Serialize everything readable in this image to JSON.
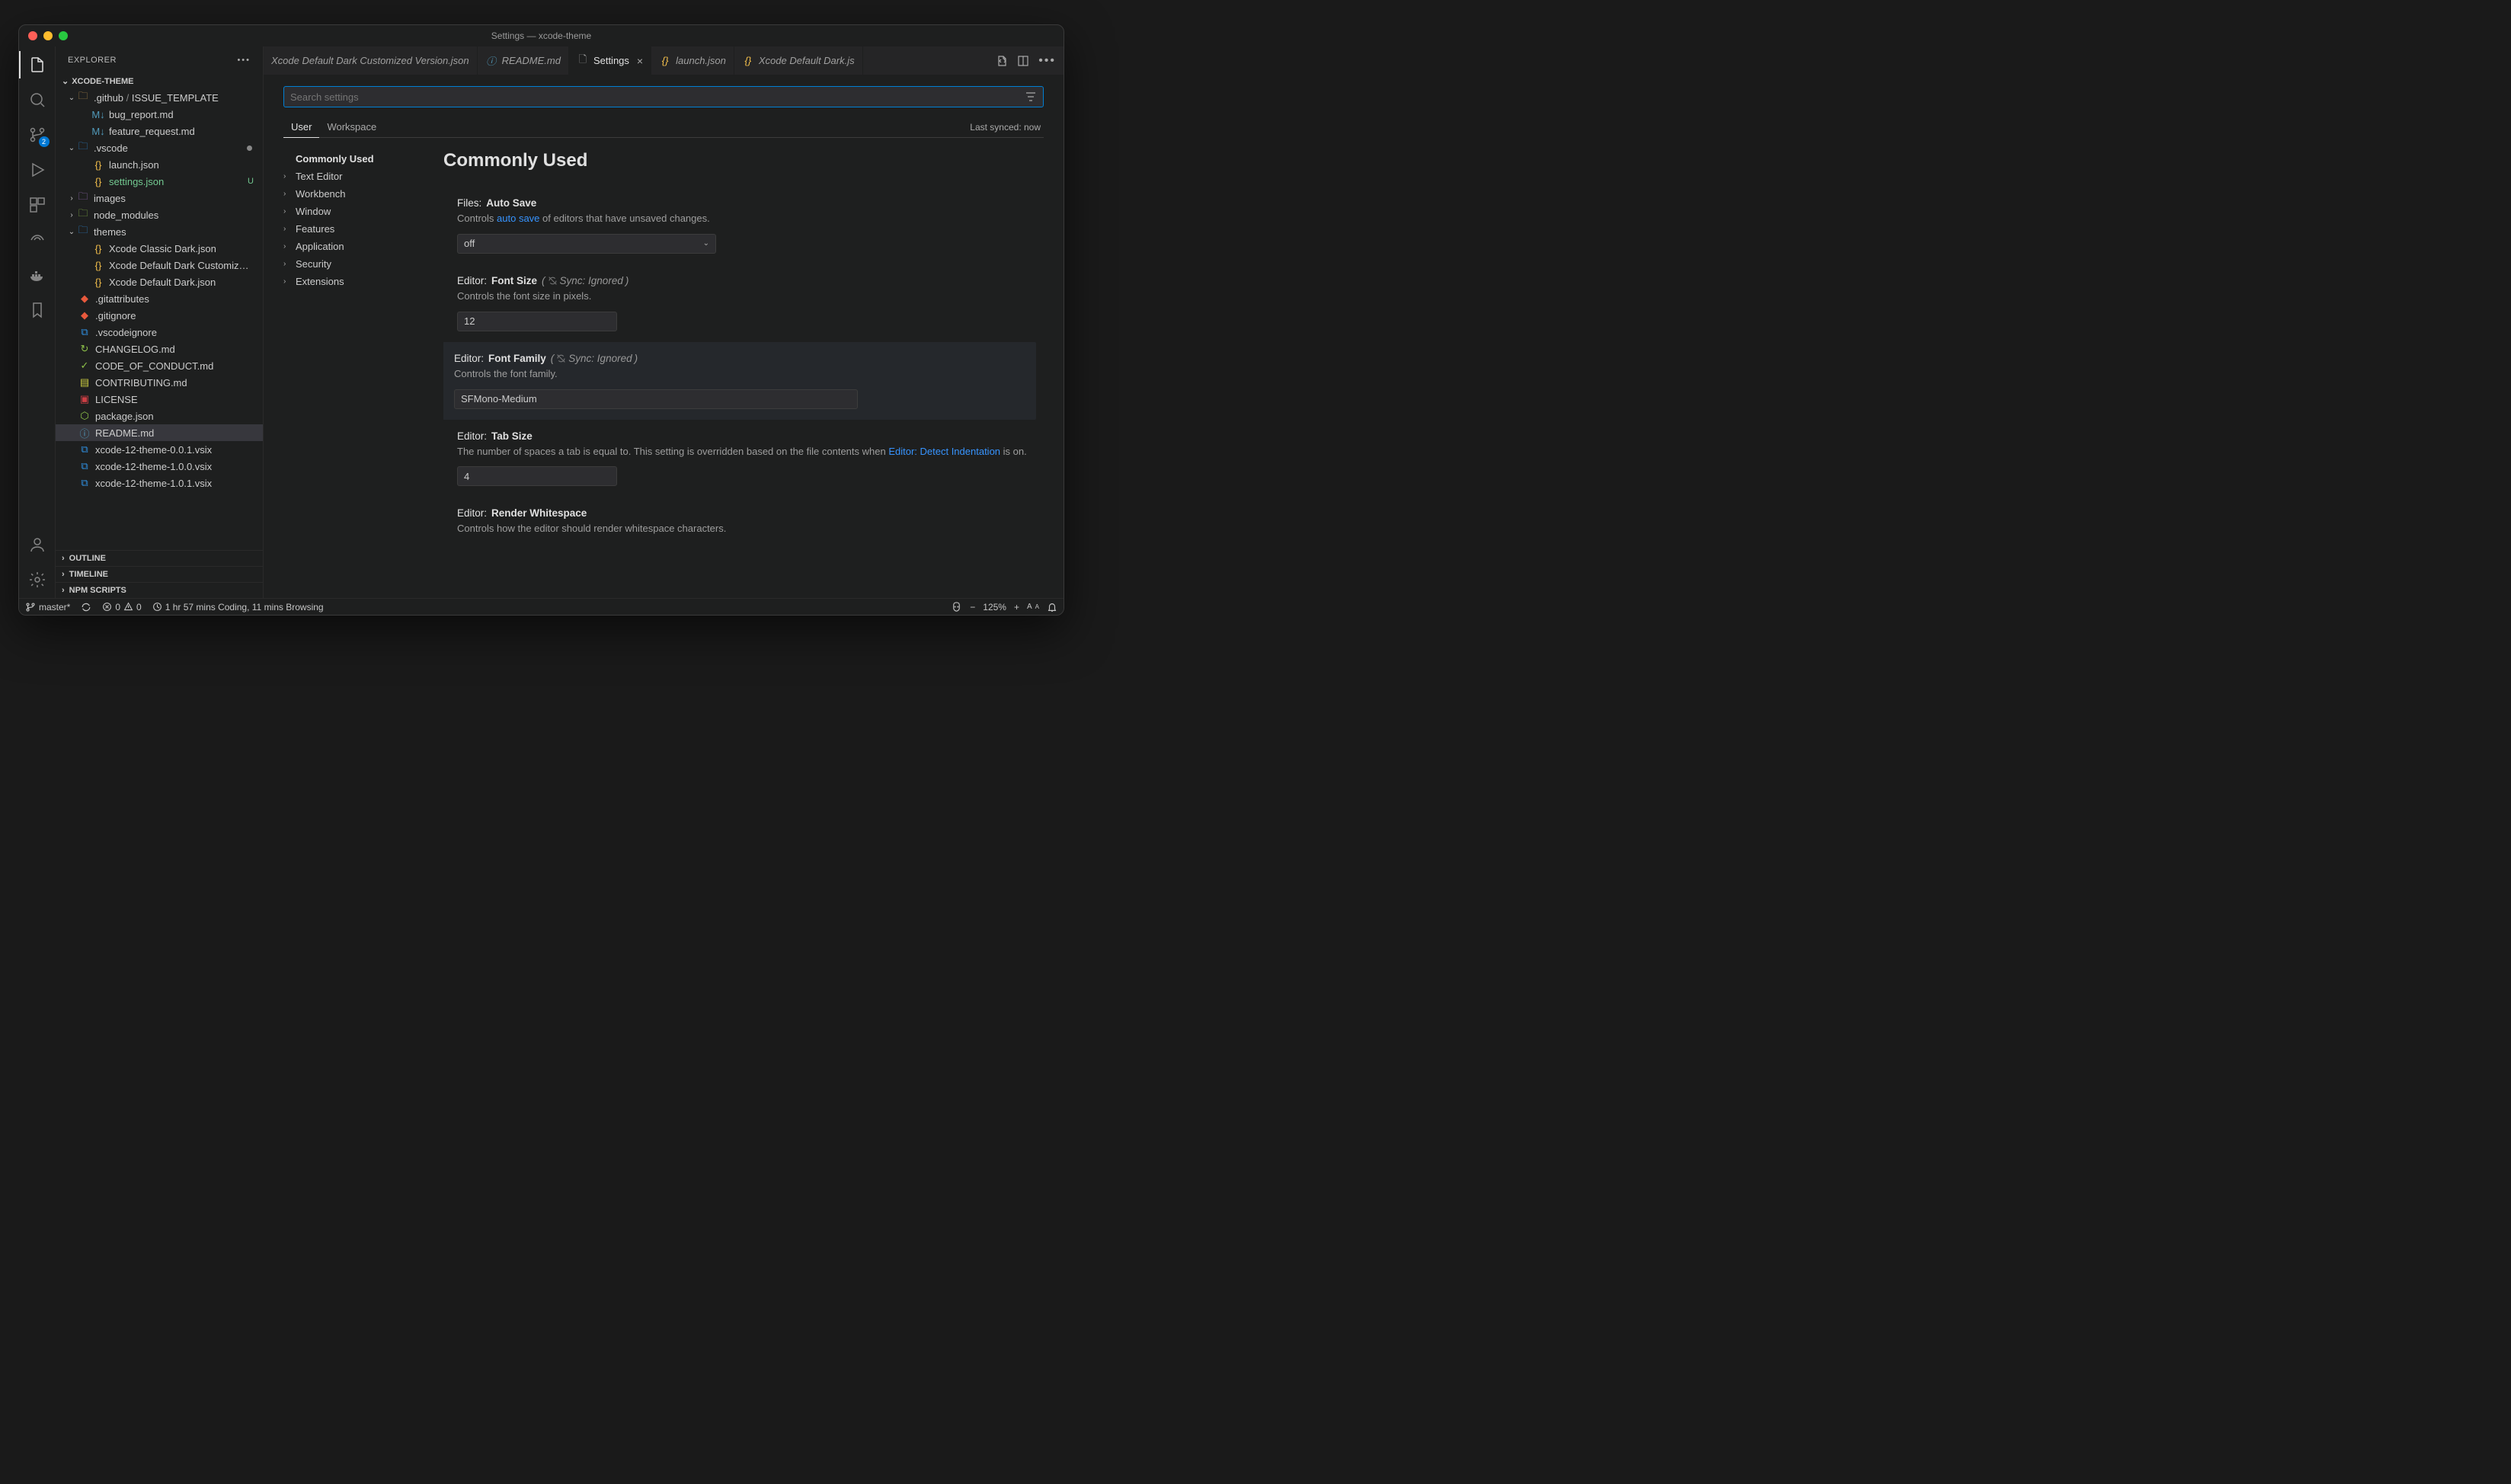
{
  "window_title": "Settings — xcode-theme",
  "explorer": {
    "title": "EXPLORER",
    "project": "XCODE-THEME"
  },
  "scm_badge": "2",
  "tree": {
    "github_folder": ".github",
    "issue_template": "ISSUE_TEMPLATE",
    "bug_report": "bug_report.md",
    "feature_request": "feature_request.md",
    "vscode_folder": ".vscode",
    "launch": "launch.json",
    "settings_json": "settings.json",
    "settings_status": "U",
    "images": "images",
    "node_modules": "node_modules",
    "themes": "themes",
    "theme_classic": "Xcode Classic Dark.json",
    "theme_custom": "Xcode Default Dark Customiz…",
    "theme_default": "Xcode Default Dark.json",
    "gitattributes": ".gitattributes",
    "gitignore": ".gitignore",
    "vscodeignore": ".vscodeignore",
    "changelog": "CHANGELOG.md",
    "coc": "CODE_OF_CONDUCT.md",
    "contributing": "CONTRIBUTING.md",
    "license": "LICENSE",
    "package_json": "package.json",
    "readme": "README.md",
    "vsix0": "xcode-12-theme-0.0.1.vsix",
    "vsix1": "xcode-12-theme-1.0.0.vsix",
    "vsix2": "xcode-12-theme-1.0.1.vsix"
  },
  "collapsed": {
    "outline": "OUTLINE",
    "timeline": "TIMELINE",
    "npm": "NPM SCRIPTS"
  },
  "tabs": {
    "t0": "Xcode Default Dark Customized Version.json",
    "t1": "README.md",
    "t2": "Settings",
    "t3": "launch.json",
    "t4": "Xcode Default Dark.js"
  },
  "search_placeholder": "Search settings",
  "scopes": {
    "user": "User",
    "workspace": "Workspace"
  },
  "last_sync": "Last synced: now",
  "toc": {
    "commonly": "Commonly Used",
    "text": "Text Editor",
    "workbench": "Workbench",
    "window": "Window",
    "features": "Features",
    "application": "Application",
    "security": "Security",
    "extensions": "Extensions"
  },
  "section_title": "Commonly Used",
  "settings": {
    "autosave": {
      "title_prefix": "Files:",
      "title": "Auto Save",
      "desc1": "Controls ",
      "desc_link": "auto save",
      "desc2": " of editors that have unsaved changes.",
      "value": "off"
    },
    "fontsize": {
      "title_prefix": "Editor:",
      "title": "Font Size",
      "sync": "Sync: Ignored",
      "desc": "Controls the font size in pixels.",
      "value": "12"
    },
    "fontfamily": {
      "title_prefix": "Editor:",
      "title": "Font Family",
      "sync": "Sync: Ignored",
      "desc": "Controls the font family.",
      "value": "SFMono-Medium"
    },
    "tabsize": {
      "title_prefix": "Editor:",
      "title": "Tab Size",
      "desc1": "The number of spaces a tab is equal to. This setting is overridden based on the file contents when ",
      "desc_link": "Editor: Detect Indentation",
      "desc2": " is on.",
      "value": "4"
    },
    "whitespace": {
      "title_prefix": "Editor:",
      "title": "Render Whitespace",
      "desc": "Controls how the editor should render whitespace characters."
    }
  },
  "status": {
    "branch": "master*",
    "errors": "0",
    "warnings": "0",
    "time": "1 hr 57 mins Coding, 11 mins Browsing",
    "zoom": "125%"
  }
}
